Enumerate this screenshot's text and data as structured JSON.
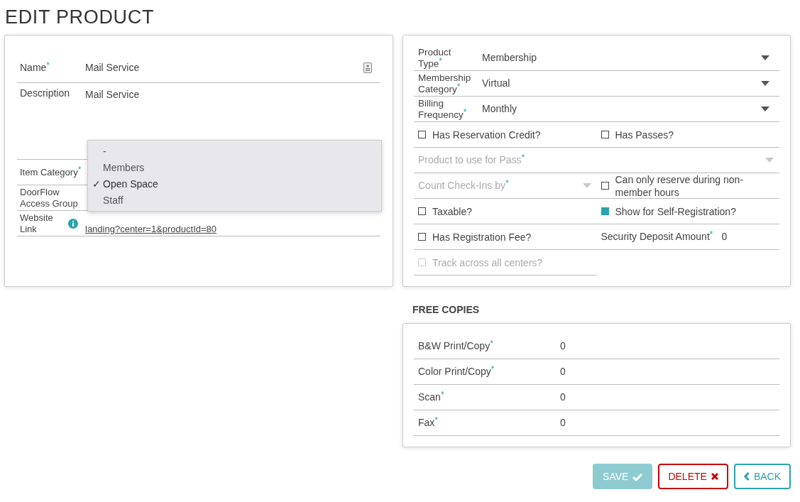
{
  "title": "EDIT PRODUCT",
  "left_panel": {
    "fields": [
      {
        "kind": "text",
        "label": "Name",
        "mark": "*",
        "value": "Mail Service"
      },
      {
        "kind": "textarea",
        "label": "Description",
        "value": "Mail Service"
      },
      {
        "kind": "select",
        "label": "Item Category",
        "mark": "*"
      },
      {
        "kind": "select",
        "label": "DoorFlow Access Group"
      },
      {
        "kind": "link",
        "label": "Website Link",
        "value": "landing?center=1&productId=80"
      }
    ],
    "menu": [
      {
        "label": "-",
        "selected": false
      },
      {
        "label": "Members",
        "selected": false
      },
      {
        "label": "Open Space",
        "selected": true,
        "tick": "✓"
      },
      {
        "label": "Staff",
        "selected": false
      }
    ]
  },
  "right_panel": {
    "fields": [
      {
        "kind": "select",
        "wide": true,
        "label": "Product Type",
        "mark": "*",
        "value": "Membership",
        "disabled": false
      },
      {
        "kind": "select",
        "wide": true,
        "label": "Membership Category",
        "mark": "*",
        "value": "Virtual",
        "disabled": false
      },
      {
        "kind": "select",
        "wide": true,
        "label": "Billing Frequency",
        "mark": "*",
        "value": "Monthly",
        "disabled": false
      },
      {
        "kind": "checkbox",
        "label": "Has Reservation Credit?",
        "checked": false,
        "disabled": false
      },
      {
        "kind": "checkbox",
        "label": "Has Passes?",
        "checked": false,
        "disabled": false
      },
      {
        "kind": "select",
        "wide": true,
        "label": "Product to use for Pass",
        "mark": "*",
        "disabled": true
      },
      {
        "kind": "select",
        "label": "Count Check-Ins by",
        "mark": "*",
        "disabled": true
      },
      {
        "kind": "checkbox",
        "label": "Can only reserve during non-member hours",
        "checked": false,
        "disabled": false
      },
      {
        "kind": "checkbox",
        "label": "Taxable?",
        "checked": false,
        "disabled": false
      },
      {
        "kind": "checkbox",
        "label": "Show for Self-Registration?",
        "checked": true,
        "disabled": false
      },
      {
        "kind": "checkbox",
        "label": "Has Registration Fee?",
        "checked": false,
        "disabled": false
      },
      {
        "kind": "amount",
        "label": "Security Deposit Amount",
        "mark": "*",
        "value": "0",
        "disabled": false
      },
      {
        "kind": "checkbox",
        "label": "Track across all centers?",
        "checked": false,
        "disabled": true
      }
    ]
  },
  "free_copies": {
    "heading": "FREE COPIES",
    "rows": [
      {
        "label": "B&W Print/Copy",
        "mark": "*",
        "value": "0"
      },
      {
        "label": "Color Print/Copy",
        "mark": "*",
        "value": "0"
      },
      {
        "label": "Scan",
        "mark": "*",
        "value": "0"
      },
      {
        "label": "Fax",
        "mark": "*",
        "value": "0"
      }
    ]
  },
  "buttons": [
    {
      "kind": "save",
      "label": "SAVE",
      "disabled": true
    },
    {
      "kind": "delete",
      "label": "DELETE",
      "disabled": false
    },
    {
      "kind": "back",
      "label": "BACK",
      "disabled": false
    }
  ]
}
